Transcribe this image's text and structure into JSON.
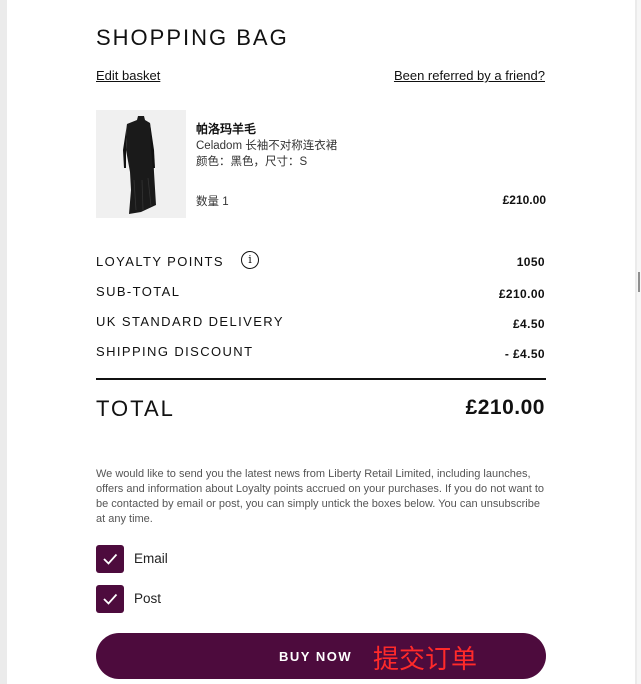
{
  "header": {
    "title": "SHOPPING BAG",
    "edit_link": "Edit basket",
    "referral_link": "Been referred by a friend?"
  },
  "item": {
    "brand": "帕洛玛羊毛",
    "name": "Celadom 长袖不对称连衣裙",
    "options": "颜色：黑色，尺寸：S",
    "quantity": "数量 1",
    "price": "£210.00",
    "image_icon": "black-dress-image"
  },
  "summary": {
    "loyalty_label": "LOYALTY POINTS",
    "loyalty_value": "1050",
    "info_icon": "i",
    "subtotal_label": "SUB-TOTAL",
    "subtotal_value": "£210.00",
    "delivery_label": "UK STANDARD DELIVERY",
    "delivery_value": "£4.50",
    "discount_label": "SHIPPING DISCOUNT",
    "discount_value": "- £4.50",
    "total_label": "TOTAL",
    "total_value": "£210.00"
  },
  "consent": {
    "text": "We would like to send you the latest news from Liberty Retail Limited, including launches, offers and information about Loyalty points accrued on your purchases. If you do not want to be contacted by email or post, you can simply untick the boxes below. You can unsubscribe at any time.",
    "email_label": "Email",
    "email_checked": true,
    "post_label": "Post",
    "post_checked": true
  },
  "checkout": {
    "buy_label": "BUY NOW",
    "annotation": "提交订单"
  },
  "colors": {
    "brand": "#4d0b3d",
    "annotation": "#ff2a2a"
  }
}
